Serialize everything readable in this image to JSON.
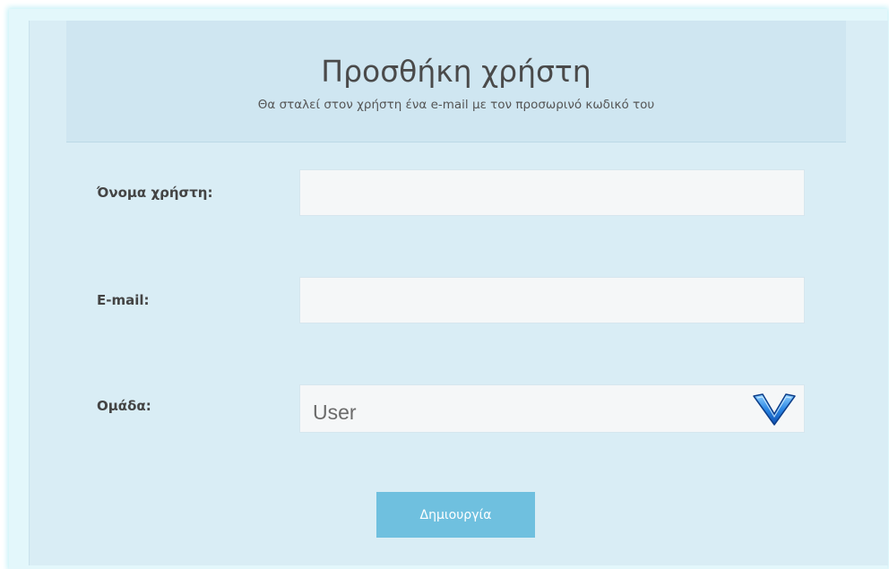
{
  "form": {
    "title": "Προσθήκη χρήστη",
    "subtitle": "Θα σταλεί στον χρήστη ένα e-mail με τον προσωρινό κωδικό του",
    "username_label": "Όνομα χρήστη:",
    "username_value": "",
    "email_label": "E-mail:",
    "email_value": "",
    "group_label": "Ομάδα:",
    "group_selected": "User",
    "submit_label": "Δημιουργία"
  },
  "icons": {
    "dropdown": "chevron-down-icon"
  },
  "colors": {
    "button": "#6fc0df",
    "header": "#cfe6f1",
    "panel": "#d9edf5",
    "chevron": "#1f6fd0"
  }
}
